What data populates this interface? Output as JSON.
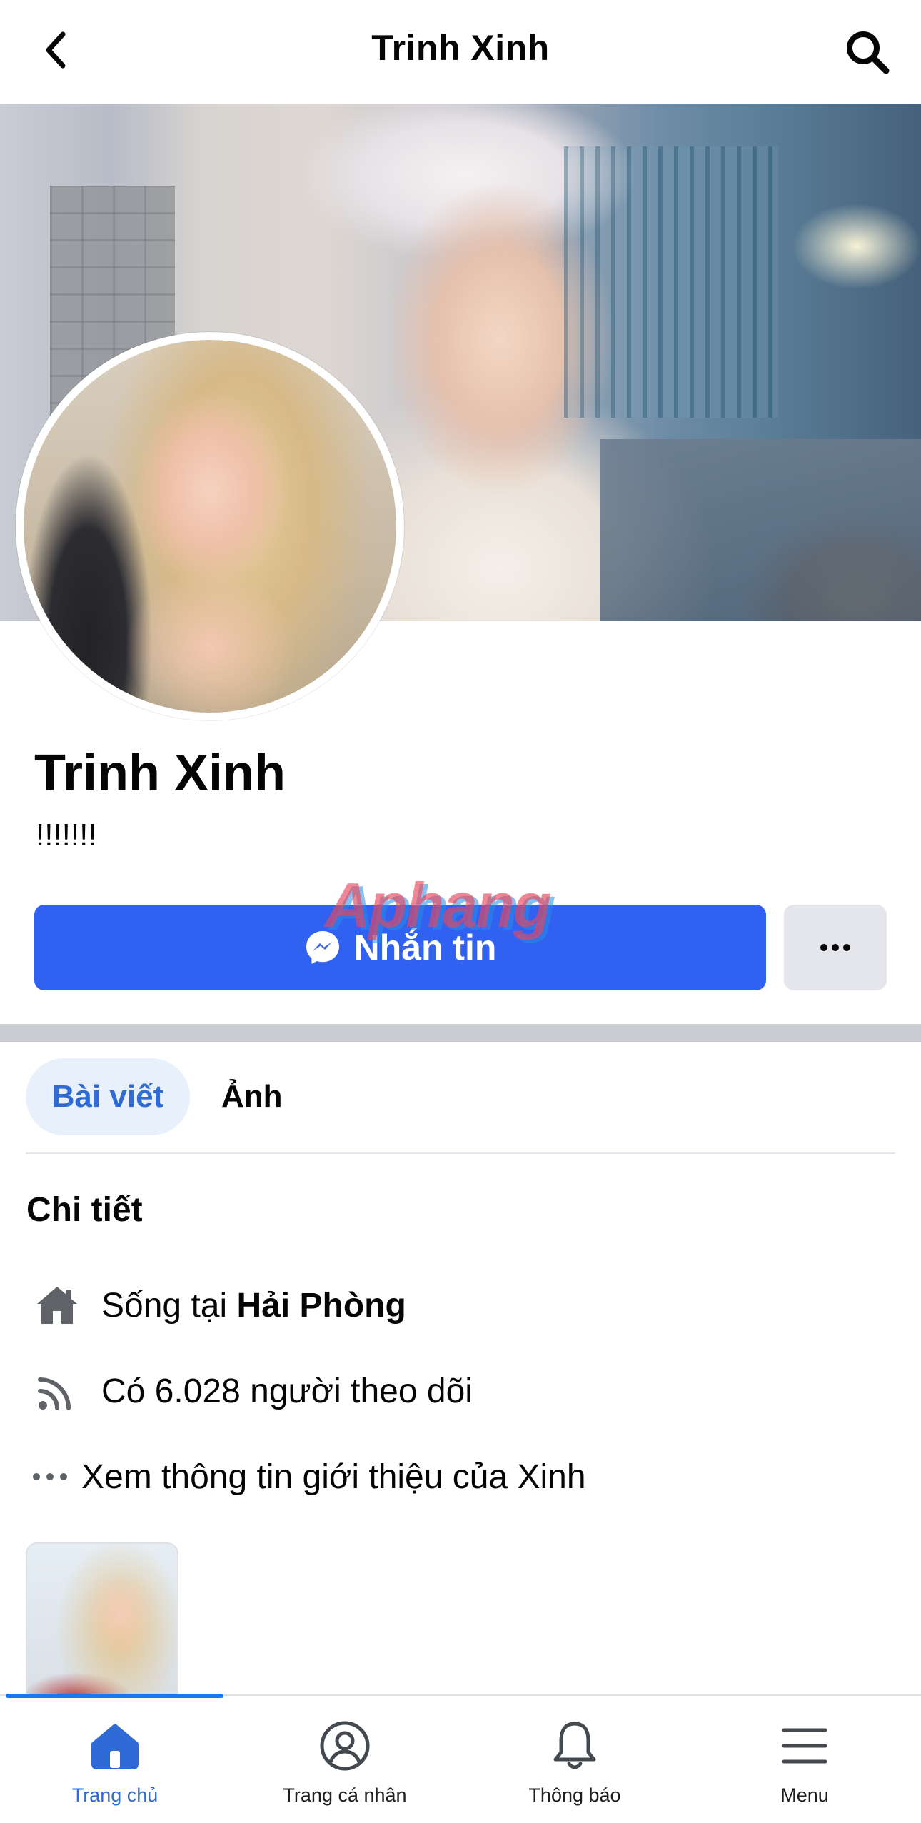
{
  "topbar": {
    "title": "Trinh Xinh",
    "back_icon": "chevron-left-icon",
    "search_icon": "search-icon"
  },
  "profile": {
    "name": "Trinh Xinh",
    "bio": "!!!!!!!"
  },
  "actions": {
    "message_label": "Nhắn tin",
    "message_icon": "messenger-icon",
    "more_icon": "more-dots-icon"
  },
  "watermark": "Aphang",
  "tabs": [
    {
      "label": "Bài viết",
      "active": true
    },
    {
      "label": "Ảnh",
      "active": false
    }
  ],
  "details": {
    "heading": "Chi tiết",
    "lives_in_prefix": "Sống tại ",
    "lives_in_place": "Hải Phòng",
    "followers_text": "Có 6.028 người theo dõi",
    "about_link": "Xem thông tin giới thiệu của Xinh"
  },
  "bottom_nav": [
    {
      "label": "Trang chủ",
      "icon": "home-icon",
      "active": true
    },
    {
      "label": "Trang cá nhân",
      "icon": "profile-icon",
      "active": false
    },
    {
      "label": "Thông báo",
      "icon": "bell-icon",
      "active": false
    },
    {
      "label": "Menu",
      "icon": "menu-icon",
      "active": false
    }
  ],
  "colors": {
    "primary_button": "#3161f0",
    "active_tab_bg": "#e7f0fb",
    "active_tab_text": "#2e6bd6",
    "secondary_button": "#e4e6eb"
  }
}
